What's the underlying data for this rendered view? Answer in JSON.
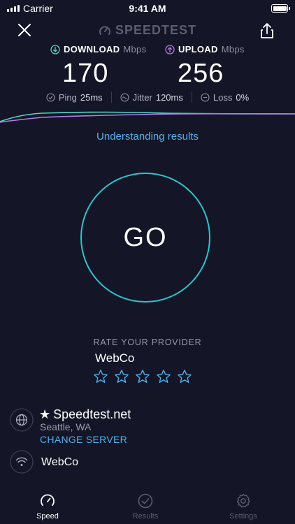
{
  "status_bar": {
    "carrier": "Carrier",
    "time": "9:41 AM"
  },
  "header": {
    "logo": "SPEEDTEST",
    "close_icon": "close-icon",
    "share_icon": "share-icon"
  },
  "metrics": {
    "download": {
      "label": "DOWNLOAD",
      "unit": "Mbps",
      "value": "170",
      "color": "#4fd6c8"
    },
    "upload": {
      "label": "UPLOAD",
      "unit": "Mbps",
      "value": "256",
      "color": "#b57bea"
    },
    "ping": {
      "label": "Ping",
      "value": "25",
      "unit": "ms"
    },
    "jitter": {
      "label": "Jitter",
      "value": "120",
      "unit": "ms"
    },
    "loss": {
      "label": "Loss",
      "value": "0",
      "unit": "%"
    }
  },
  "understanding_link": "Understanding results",
  "go_button": "GO",
  "rate": {
    "title": "RATE YOUR PROVIDER",
    "provider": "WebCo",
    "stars_total": 5,
    "stars_filled": 0
  },
  "server": {
    "name": "Speedtest.net",
    "location": "Seattle, WA",
    "change_label": "CHANGE SERVER"
  },
  "isp": "WebCo",
  "tabs": [
    {
      "label": "Speed",
      "icon": "speedometer-icon",
      "active": true
    },
    {
      "label": "Results",
      "icon": "check-circle-icon",
      "active": false
    },
    {
      "label": "Settings",
      "icon": "gear-icon",
      "active": false
    }
  ],
  "colors": {
    "background": "#141526",
    "accent_blue": "#4fb2ee",
    "go_ring": "#2cc4cc"
  }
}
